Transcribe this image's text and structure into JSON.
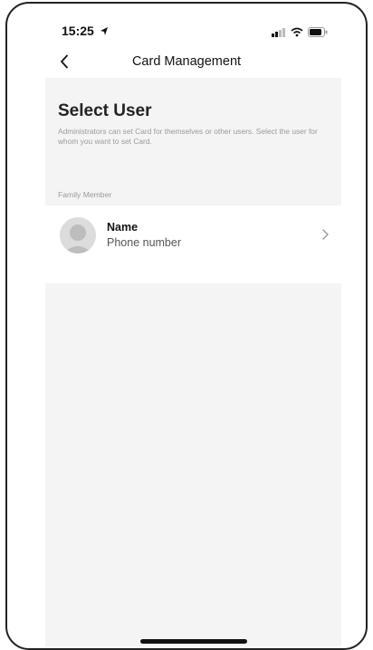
{
  "status_bar": {
    "time": "15:25",
    "location_icon": "location-arrow-icon",
    "signal_icon": "cellular-signal-icon",
    "wifi_icon": "wifi-icon",
    "battery_icon": "battery-icon"
  },
  "nav": {
    "back_icon": "chevron-left-icon",
    "title": "Card Management"
  },
  "header": {
    "title": "Select User",
    "description": "Administrators can set Card for themselves or other users. Select the user for whom you want to set Card."
  },
  "section": {
    "label": "Family Member"
  },
  "users": [
    {
      "name": "Name",
      "phone": "Phone number",
      "avatar_icon": "default-avatar-icon",
      "chevron_icon": "chevron-right-icon"
    }
  ],
  "colors": {
    "panel_background": "#f3f4f3",
    "row_background": "#ffffff",
    "muted_text": "#9a9a9a"
  }
}
